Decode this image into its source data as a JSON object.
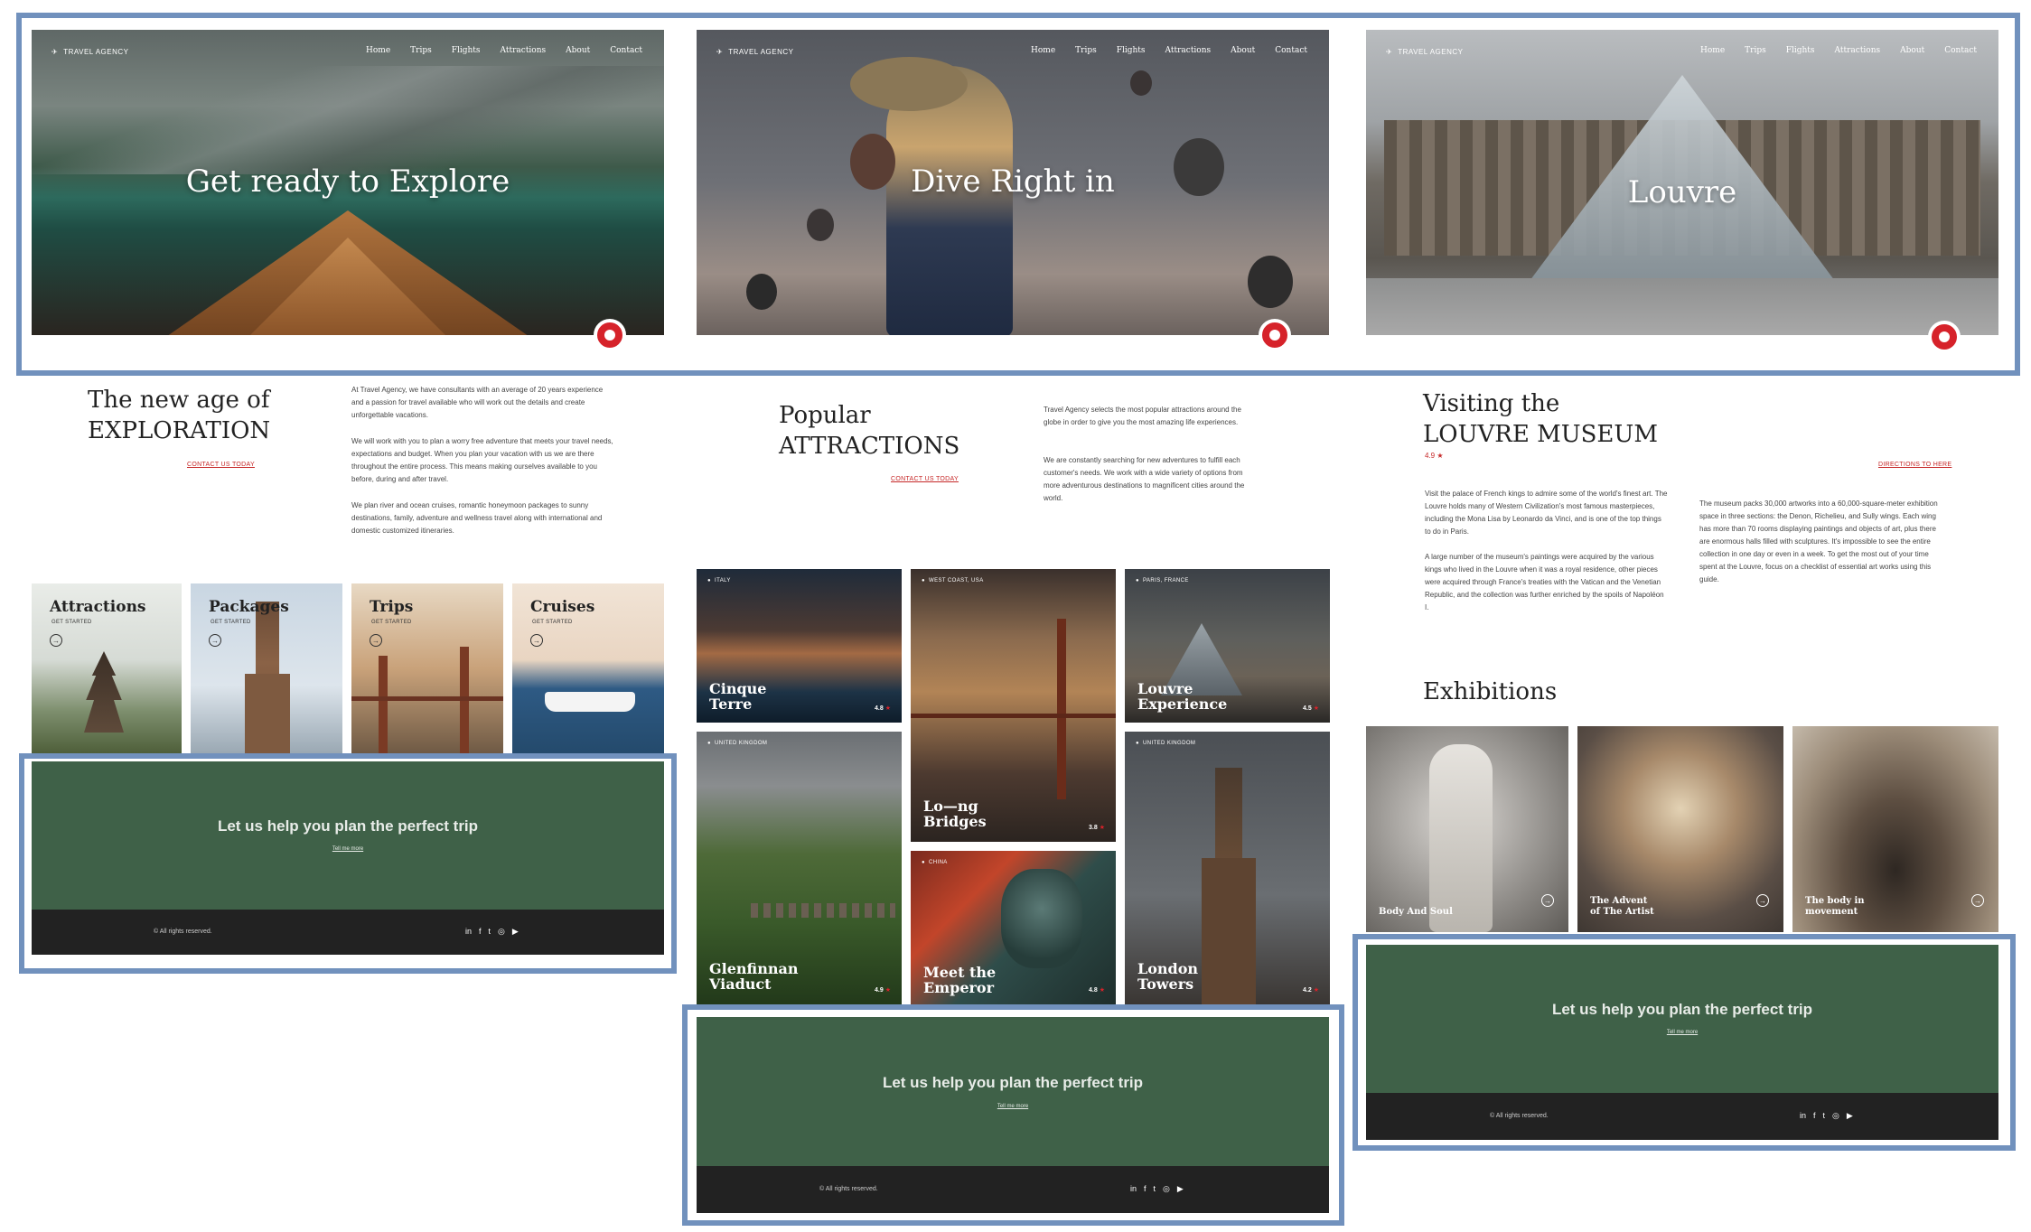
{
  "brand": "TRAVEL AGENCY",
  "nav": [
    "Home",
    "Trips",
    "Flights",
    "Attractions",
    "About",
    "Contact"
  ],
  "colors": {
    "accent": "#d6222a",
    "cta_green": "#3f6148",
    "footer": "#222222",
    "frame": "#7191bd"
  },
  "page1": {
    "hero_title": "Get ready to Explore",
    "heading_line1": "The new age of",
    "heading_line2": "EXPLORATION",
    "contact_link": "CONTACT US TODAY",
    "para1": "At Travel Agency, we have consultants with an average of 20 years experience and a passion for travel available who will work out the details and create unforgettable vacations.",
    "para2": "We will work with you to plan a worry free adventure that meets your travel needs, expectations and budget. When you plan your vacation with us we are there throughout the entire process.  This means making ourselves available to you before, during and after travel.",
    "para3": "We plan river and ocean cruises, romantic honeymoon packages to sunny destinations, family, adventure and wellness travel along with international and domestic customized itineraries.",
    "categories": [
      {
        "title": "Attractions",
        "cta": "GET STARTED"
      },
      {
        "title": "Packages",
        "cta": "GET STARTED"
      },
      {
        "title": "Trips",
        "cta": "GET STARTED"
      },
      {
        "title": "Cruises",
        "cta": "GET STARTED"
      }
    ]
  },
  "page2": {
    "hero_title": "Dive Right in",
    "heading_line1": "Popular",
    "heading_line2": "ATTRACTIONS",
    "contact_link": "CONTACT US TODAY",
    "para1": "Travel Agency selects the most popular attractions around the globe in order to give you the most amazing life experiences.",
    "para2": "We are constantly searching for new adventures to fulfill each customer's needs. We work with a wide variety of options from more adventurous destinations to magnificent cities around the world.",
    "cards": [
      {
        "loc": "ITALY",
        "title1": "Cinque",
        "title2": "Terre",
        "rating": "4.8"
      },
      {
        "loc": "WEST COAST, USA",
        "title1": "Lo—ng",
        "title2": "Bridges",
        "rating": "3.8"
      },
      {
        "loc": "PARIS, FRANCE",
        "title1": "Louvre",
        "title2": "Experience",
        "rating": "4.5"
      },
      {
        "loc": "UNITED KINGDOM",
        "title1": "Glenfinnan",
        "title2": "Viaduct",
        "rating": "4.9"
      },
      {
        "loc": "CHINA",
        "title1": "Meet the",
        "title2": "Emperor",
        "rating": "4.8"
      },
      {
        "loc": "UNITED KINGDOM",
        "title1": "London",
        "title2": "Towers",
        "rating": "4.2"
      }
    ]
  },
  "page3": {
    "hero_title": "Louvre",
    "heading_line1": "Visiting the",
    "heading_line2": "LOUVRE MUSEUM",
    "rating": "4.9",
    "directions_link": "DIRECTIONS TO HERE",
    "para1": "Visit the palace of French kings to admire some of the world's finest art. The Louvre holds many of Western Civilization's most famous masterpieces, including the Mona Lisa by Leonardo da Vinci, and is one of the top things to do in Paris.",
    "para2": "A large number of the museum's paintings were acquired by the various kings who lived in the Louvre when it was a royal residence, other pieces were acquired through France's treaties with the Vatican and the Venetian Republic, and the collection was further enriched by the spoils of Napoléon I.",
    "para3": "The museum packs 30,000 artworks into a 60,000-square-meter exhibition space in three sections: the Denon, Richelieu, and Sully wings. Each wing has more than 70 rooms displaying paintings and objects of art, plus there are enormous halls filled with sculptures. It's impossible to see the entire collection in one day or even in a week. To get the most out of your time spent at the Louvre, focus on a checklist of essential art works using this guide.",
    "exhibitions_title": "Exhibitions",
    "exhibitions": [
      {
        "title1": "Body And Soul",
        "title2": ""
      },
      {
        "title1": "The Advent",
        "title2": "of The Artist"
      },
      {
        "title1": "The body in",
        "title2": "movement"
      }
    ]
  },
  "cta": {
    "title": "Let us help you plan the perfect trip",
    "link": "Tell me more"
  },
  "footer": {
    "copyright": "© All rights reserved.",
    "social": [
      "linkedin-icon",
      "facebook-icon",
      "twitter-icon",
      "instagram-icon",
      "youtube-icon"
    ]
  }
}
